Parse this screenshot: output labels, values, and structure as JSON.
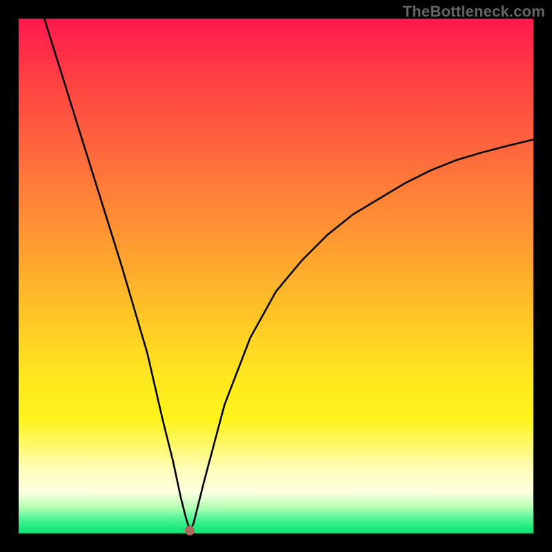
{
  "watermark": "TheBottleneck.com",
  "chart_data": {
    "type": "line",
    "title": "",
    "xlabel": "",
    "ylabel": "",
    "xlim": [
      0,
      100
    ],
    "ylim": [
      0,
      100
    ],
    "grid": false,
    "series": [
      {
        "name": "bottleneck-curve",
        "x": [
          5,
          10,
          15,
          20,
          25,
          28,
          30,
          31.5,
          32.5,
          33.3,
          34,
          36,
          40,
          45,
          50,
          55,
          60,
          65,
          70,
          75,
          80,
          85,
          90,
          95,
          100
        ],
        "y": [
          100,
          84,
          68,
          52,
          35,
          22,
          14,
          7,
          3,
          0.5,
          2,
          10,
          25,
          38,
          47,
          53,
          58,
          62,
          65,
          68,
          70.5,
          72.5,
          74,
          75.3,
          76.5
        ]
      }
    ],
    "marker": {
      "name": "min-point",
      "x": 33.3,
      "y": 0.5,
      "color": "#b06a58"
    },
    "background_gradient": {
      "top": "#ff184e",
      "mid": "#ffe81e",
      "bottom": "#13e173"
    }
  }
}
